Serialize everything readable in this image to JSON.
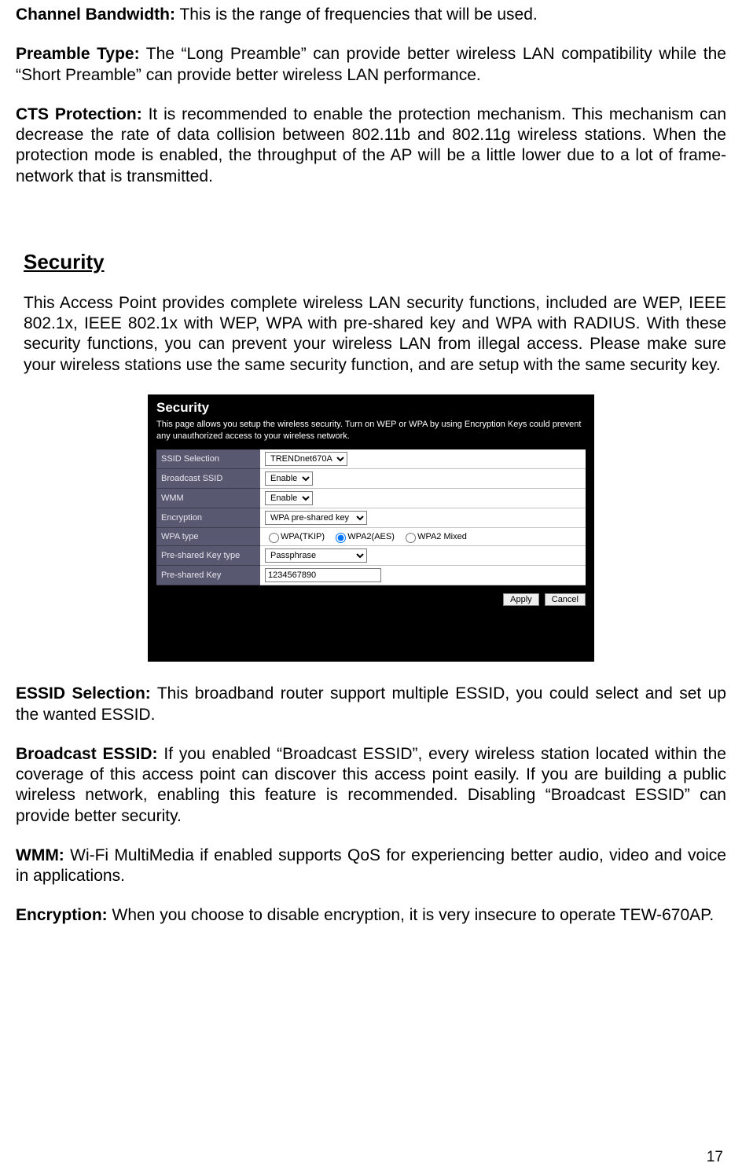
{
  "para_channel_bw_label": "Channel Bandwidth:",
  "para_channel_bw_text": "  This is the range of frequencies that will be used.",
  "para_preamble_label": "Preamble Type:",
  "para_preamble_text": " The “Long Preamble” can provide better wireless LAN compatibility while the “Short Preamble” can provide better wireless LAN performance.",
  "para_cts_label": "CTS Protection:",
  "para_cts_text": " It is recommended to enable the protection mechanism. This mechanism can decrease the rate of data collision between 802.11b and 802.11g wireless stations. When the protection mode is enabled, the throughput of the AP will be a little lower due to a lot of frame-network that is transmitted.",
  "section_security_title": "Security",
  "para_security_intro": "This Access Point provides complete wireless LAN security functions, included are WEP, IEEE 802.1x, IEEE 802.1x with WEP, WPA with pre-shared key and WPA with RADIUS. With these security functions, you can prevent your wireless LAN from illegal access. Please make sure your wireless stations use the same security function, and are setup with the same security key.",
  "panel": {
    "title": "Security",
    "desc": "This page allows you setup the wireless security. Turn on WEP or WPA by using Encryption Keys could prevent any unauthorized access to your wireless network.",
    "rows": {
      "ssid_label": "SSID Selection",
      "ssid_value": "TRENDnet670A",
      "broadcast_label": "Broadcast SSID",
      "broadcast_value": "Enable",
      "wmm_label": "WMM",
      "wmm_value": "Enable",
      "encryption_label": "Encryption",
      "encryption_value": "WPA pre-shared key",
      "wpatype_label": "WPA type",
      "wpatype_opt1": "WPA(TKIP)",
      "wpatype_opt2": "WPA2(AES)",
      "wpatype_opt3": "WPA2 Mixed",
      "psktype_label": "Pre-shared Key type",
      "psktype_value": "Passphrase",
      "psk_label": "Pre-shared Key",
      "psk_value": "1234567890"
    },
    "apply": "Apply",
    "cancel": "Cancel"
  },
  "para_essid_sel_label": "ESSID Selection:",
  "para_essid_sel_text": " This broadband router support multiple ESSID, you could select and set up the wanted ESSID.",
  "para_broadcast_label": "Broadcast ESSID:",
  "para_broadcast_text": " If you enabled “Broadcast ESSID”, every wireless station located within the coverage of this access point can discover this access point easily. If you are building a public wireless network, enabling this feature is recommended. Disabling “Broadcast ESSID” can provide better security.",
  "para_wmm_label": "WMM:",
  "para_wmm_text": " Wi-Fi MultiMedia if enabled supports QoS for experiencing better audio, video and voice in applications.",
  "para_enc_label": "Encryption:",
  "para_enc_text": " When you choose to disable encryption, it is very insecure to operate TEW-670AP.",
  "page_number": "17"
}
